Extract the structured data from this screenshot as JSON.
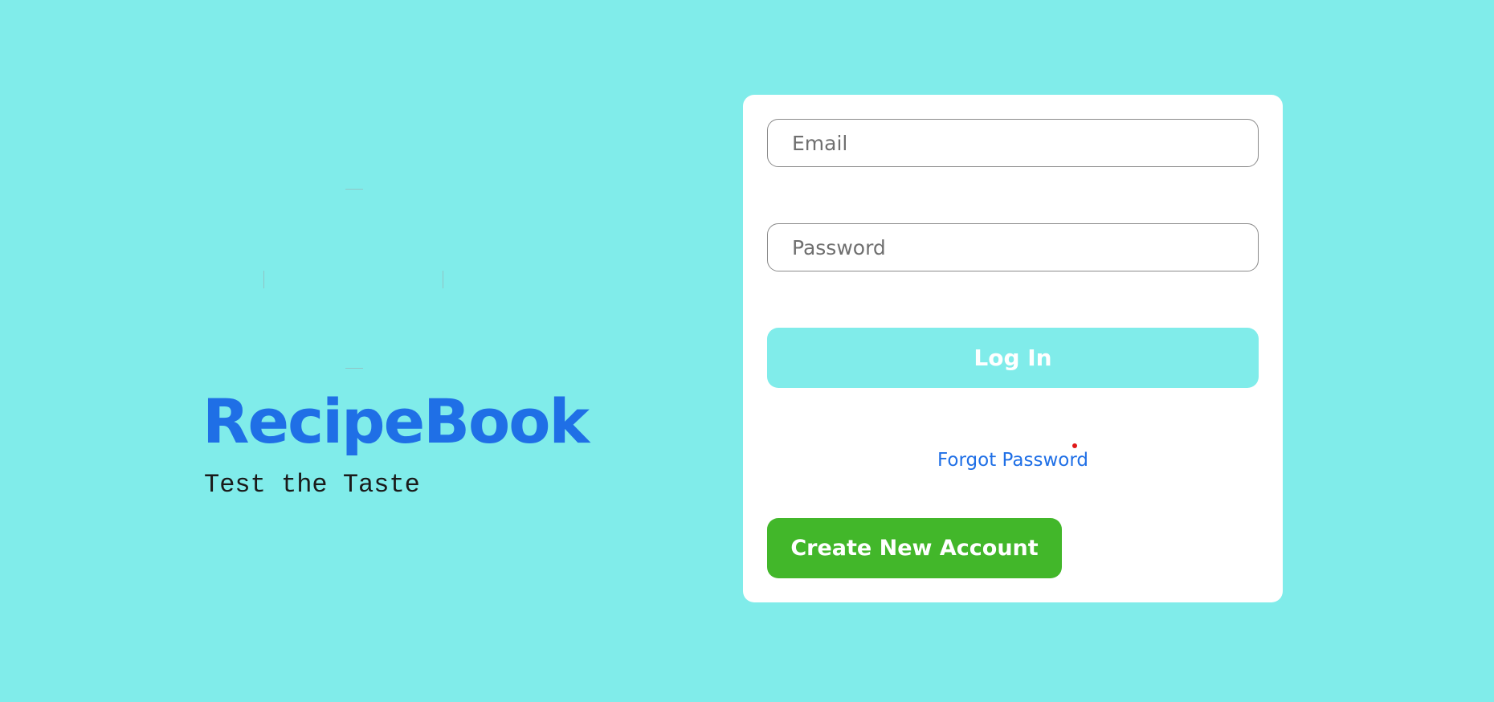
{
  "colors": {
    "background": "#80ecea",
    "brand_blue": "#1f6fe6",
    "login_button": "#80ecea",
    "create_button": "#42b72a",
    "card": "#ffffff"
  },
  "brand": {
    "logo_icon": "logo-image-icon",
    "title": "RecipeBook",
    "tagline": "Test the Taste"
  },
  "login_form": {
    "email_placeholder": "Email",
    "password_placeholder": "Password",
    "login_label": "Log In",
    "forgot_password_label": "Forgot Password",
    "create_account_label": "Create New Account"
  }
}
